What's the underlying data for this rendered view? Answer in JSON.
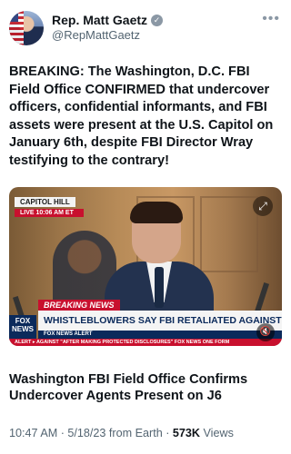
{
  "author": {
    "name": "Rep. Matt Gaetz",
    "handle": "@RepMattGaetz",
    "verified_glyph": "✓",
    "verified_icon": "gray-verified-check-icon"
  },
  "more_icon": "more-horizontal-icon",
  "tweet_text": "BREAKING: The Washington, D.C. FBI Field Office CONFIRMED that undercover officers, confidential informants, and FBI assets were present at the U.S. Capitol on January 6th, despite FBI Director Wray testifying to the contrary!",
  "media": {
    "channel_tag_top": "CAPITOL HILL",
    "channel_tag_bottom": "LIVE  10:06 AM ET",
    "breaking_label": "BREAKING NEWS",
    "headline": "WHISTLEBLOWERS SAY FBI RETALIATED AGAINST THEM",
    "alert_line": "FOX NEWS ALERT",
    "ticker": "ALERT ▸  AGAINST \"AFTER MAKING PROTECTED DISCLOSURES\"   FOX NEWS ONE FORM",
    "network_logo_line1": "FOX",
    "network_logo_line2": "NEWS",
    "expand_icon": "expand-icon",
    "volume_icon": "volume-muted-icon"
  },
  "link_card_title": "Washington FBI Field Office Confirms Undercover Agents Present on J6",
  "meta": {
    "time_date_source": "10:47 AM · 5/18/23 from Earth · ",
    "views_count": "573K",
    "views_label": " Views"
  },
  "colors": {
    "text_primary": "#0f1419",
    "text_secondary": "#536471",
    "fox_red": "#c8102e",
    "fox_navy": "#0b2a5b"
  }
}
